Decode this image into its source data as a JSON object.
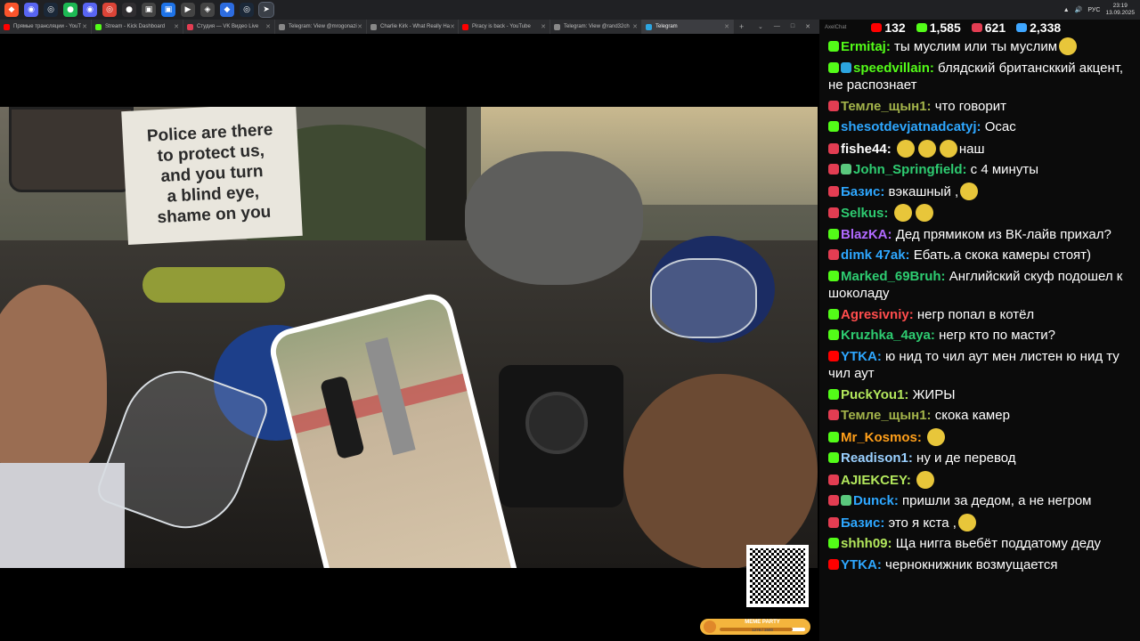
{
  "taskbar": {
    "icons": [
      {
        "name": "browser-brave-icon",
        "glyph": "◆",
        "color": "#fb542b"
      },
      {
        "name": "discord-icon",
        "glyph": "◉",
        "color": "#5865f2"
      },
      {
        "name": "steam-icon",
        "glyph": "◎",
        "color": "#1b2838"
      },
      {
        "name": "spotify-icon",
        "glyph": "●",
        "color": "#1db954"
      },
      {
        "name": "discord-icon-2",
        "glyph": "◉",
        "color": "#5865f2"
      },
      {
        "name": "chrome-icon",
        "glyph": "◎",
        "color": "#db4437"
      },
      {
        "name": "obs-icon",
        "glyph": "●",
        "color": "#302e31"
      },
      {
        "name": "app-icon",
        "glyph": "▣",
        "color": "#444"
      },
      {
        "name": "app-icon-2",
        "glyph": "▣",
        "color": "#1e73e8"
      },
      {
        "name": "app-icon-3",
        "glyph": "▶",
        "color": "#444"
      },
      {
        "name": "app-icon-4",
        "glyph": "◈",
        "color": "#444"
      },
      {
        "name": "app-icon-5",
        "glyph": "◆",
        "color": "#2d6cdf"
      },
      {
        "name": "steam-icon-2",
        "glyph": "◎",
        "color": "#1b2838"
      },
      {
        "name": "telegram-icon",
        "glyph": "➤",
        "color": "#2ca5e0",
        "active": true
      }
    ],
    "lang": "РУС",
    "time": "23:19",
    "date": "13.09.2025"
  },
  "tabs": [
    {
      "title": "Прямые трансляции - YouT",
      "fav": "#ff0000"
    },
    {
      "title": "Stream - Kick Dashboard",
      "fav": "#53fc18"
    },
    {
      "title": "Студия — VK Видео Live",
      "fav": "#e33d52"
    },
    {
      "title": "Telegram: View @mrogonazi",
      "fav": "#888"
    },
    {
      "title": "Charlie Kirk - What Really Ha",
      "fav": "#888"
    },
    {
      "title": "Piracy is back - YouTube",
      "fav": "#ff0000"
    },
    {
      "title": "Telegram: View @rand32ch",
      "fav": "#888"
    },
    {
      "title": "Telegram",
      "fav": "#2ca5e0",
      "active": true
    }
  ],
  "video": {
    "sign_lines": "Police are there\nto protect us,\nand you turn\na blind eye,\nshame on you"
  },
  "meme_party": {
    "label": "MEME PARTY",
    "count": "1276 / 1500",
    "progress": 0.85
  },
  "chat": {
    "app_name": "AxelChat",
    "stats": [
      {
        "platform": "youtube",
        "value": "132",
        "color": "#ff0000"
      },
      {
        "platform": "kick",
        "value": "1,585",
        "color": "#53fc18"
      },
      {
        "platform": "vk",
        "value": "621",
        "color": "#e33d52"
      },
      {
        "platform": "total",
        "value": "2,338",
        "color": "#3ea6ff"
      }
    ],
    "messages": [
      {
        "badges": [
          "kick"
        ],
        "nick": "Ermitaj:",
        "color": "#53fc18",
        "text": "ты муслим или ты муслим",
        "emotes_after": 1
      },
      {
        "badges": [
          "kick",
          "tg"
        ],
        "nick": "speedvillain:",
        "color": "#53fc18",
        "text": "блядский британсккий акцент, не распознает"
      },
      {
        "badges": [
          "vk"
        ],
        "nick": "Темле_щын1:",
        "color": "#a3b34a",
        "text": "что говорит"
      },
      {
        "badges": [
          "kick"
        ],
        "nick": "shesotdevjatnadcatyj:",
        "color": "#2ea7ff",
        "text": "Осас"
      },
      {
        "badges": [
          "vk"
        ],
        "nick": "fishe44:",
        "color": "#ffffff",
        "text": "наш",
        "emotes_before": 3
      },
      {
        "badges": [
          "vk",
          "mod"
        ],
        "nick": "John_Springfield:",
        "color": "#2ecc71",
        "text": "с 4 минуты"
      },
      {
        "badges": [
          "vk"
        ],
        "nick": "Базис:",
        "color": "#2ea7ff",
        "text": "вэкашный ,",
        "emotes_after": 1
      },
      {
        "badges": [
          "vk"
        ],
        "nick": "Selkus:",
        "color": "#2ecc71",
        "text": "",
        "emotes_after": 2
      },
      {
        "badges": [
          "kick"
        ],
        "nick": "BlazKA:",
        "color": "#b069ff",
        "text": "Дед прямиком из ВК-лайв прихал?"
      },
      {
        "badges": [
          "vk"
        ],
        "nick": "dimk 47ak:",
        "color": "#2ea7ff",
        "text": "Ебать.а скока камеры стоят)"
      },
      {
        "badges": [
          "kick"
        ],
        "nick": "Marked_69Bruh:",
        "color": "#2ecc71",
        "text": "Английский скуф подошел к шоколаду"
      },
      {
        "badges": [
          "kick"
        ],
        "nick": "Agresivniy:",
        "color": "#ff4d4d",
        "text": "негр попал в котёл"
      },
      {
        "badges": [
          "kick"
        ],
        "nick": "Kruzhka_4aya:",
        "color": "#2ecc71",
        "text": "негр кто по масти?"
      },
      {
        "badges": [
          "yt"
        ],
        "nick": "YTKA:",
        "color": "#2ea7ff",
        "text": "ю нид то чил аут мен листен ю нид ту чил аут"
      },
      {
        "badges": [
          "kick"
        ],
        "nick": "PuckYou1:",
        "color": "#b3e85c",
        "text": "ЖИРЫ"
      },
      {
        "badges": [
          "vk"
        ],
        "nick": "Темле_щын1:",
        "color": "#a3b34a",
        "text": "скока камер"
      },
      {
        "badges": [
          "kick"
        ],
        "nick": "Mr_Kosmos:",
        "color": "#ff9f1a",
        "text": "",
        "emotes_after": 1
      },
      {
        "badges": [
          "kick"
        ],
        "nick": "Readison1:",
        "color": "#9ad0ff",
        "text": "ну и де перевод"
      },
      {
        "badges": [
          "vk"
        ],
        "nick": "AJIEKCEY:",
        "color": "#b3e85c",
        "text": "",
        "emotes_after": 1
      },
      {
        "badges": [
          "vk",
          "mod"
        ],
        "nick": "Dunck:",
        "color": "#2ea7ff",
        "text": "пришли за дедом, а не негром"
      },
      {
        "badges": [
          "vk"
        ],
        "nick": "Базис:",
        "color": "#2ea7ff",
        "text": "это я кста ,",
        "emotes_after": 1
      },
      {
        "badges": [
          "kick"
        ],
        "nick": "shhh09:",
        "color": "#b3e85c",
        "text": "Ща нигга вьебёт поддатому деду"
      },
      {
        "badges": [
          "yt"
        ],
        "nick": "YTKA:",
        "color": "#2ea7ff",
        "text": "чернокнижник возмущается"
      }
    ]
  }
}
